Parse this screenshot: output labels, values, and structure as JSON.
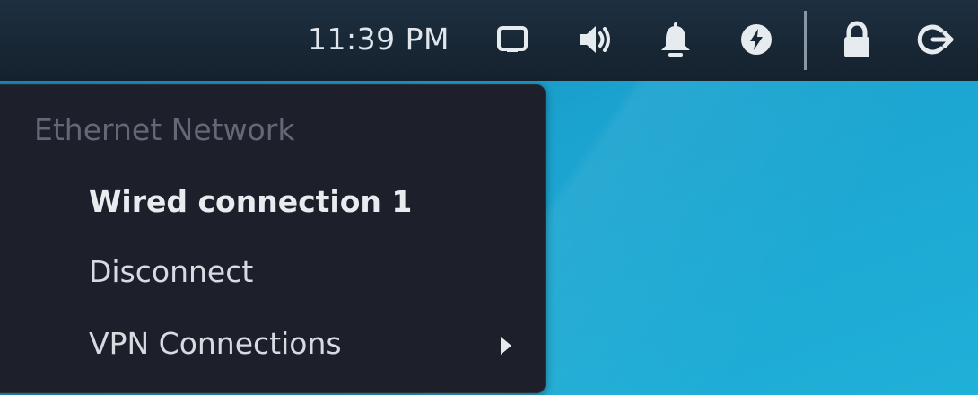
{
  "panel": {
    "clock": "11:39 PM",
    "icons": [
      "display-icon",
      "volume-icon",
      "bell-icon",
      "power-icon",
      "lock-icon",
      "logout-icon"
    ]
  },
  "network_menu": {
    "header": "Ethernet Network",
    "items": [
      {
        "label": "Wired connection 1",
        "active": true
      },
      {
        "label": "Disconnect",
        "active": false
      },
      {
        "label": "VPN Connections",
        "has_submenu": true
      }
    ]
  },
  "colors": {
    "panel": "#1a2937",
    "menu": "#1d1f2b",
    "desktop": "#1ba3cf",
    "text": "#d7dbe0",
    "header_text": "#646874"
  }
}
